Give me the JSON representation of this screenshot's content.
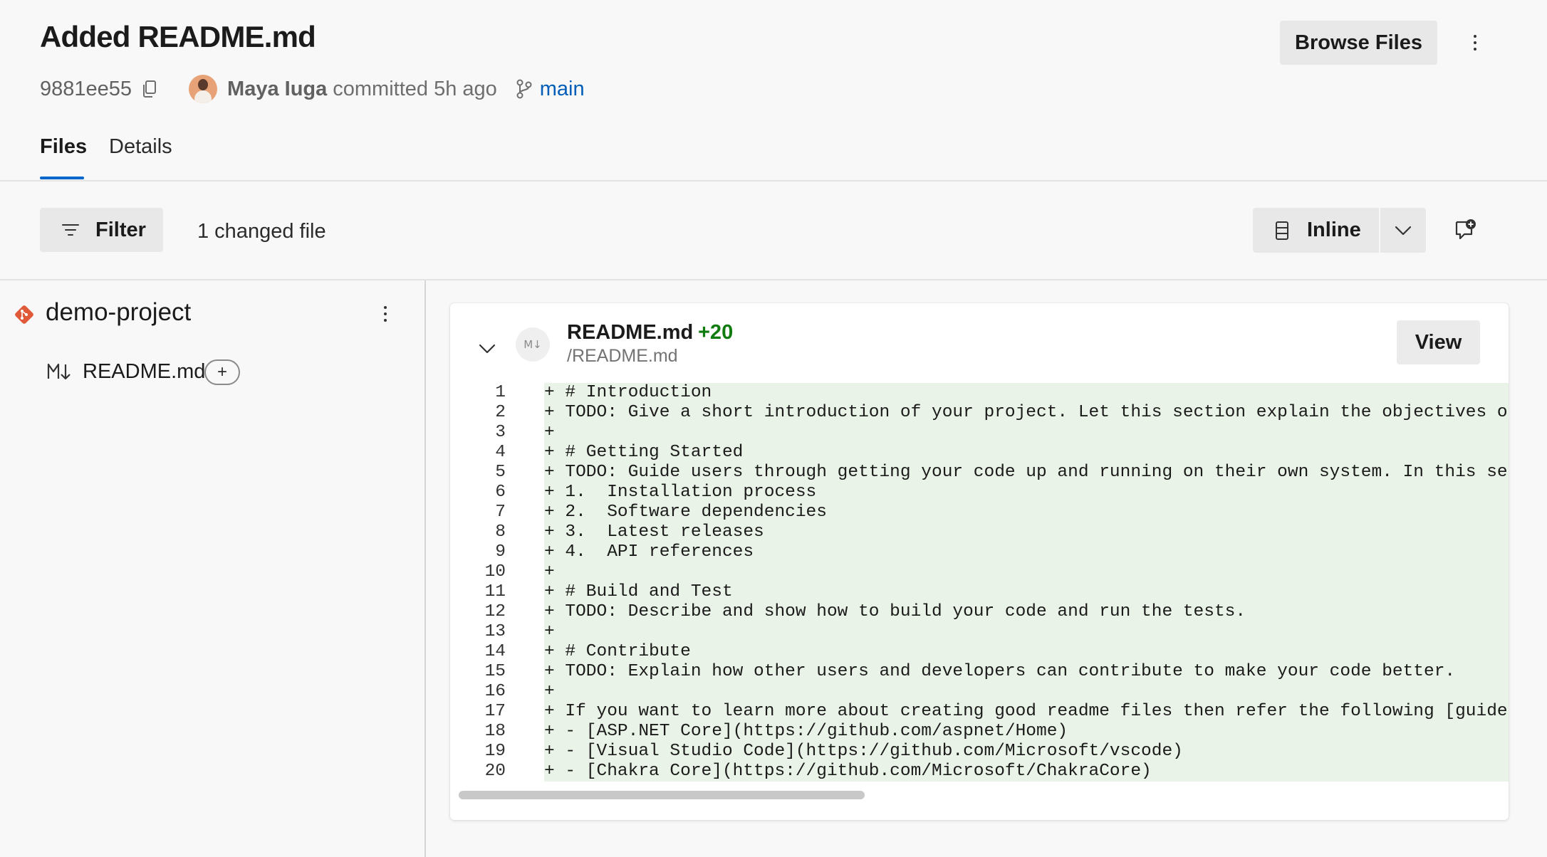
{
  "commit": {
    "title": "Added README.md",
    "hash": "9881ee55",
    "author": "Maya Iuga",
    "committed_text": "committed 5h ago",
    "branch": "main"
  },
  "header": {
    "browse_files_label": "Browse Files"
  },
  "tabs": [
    {
      "label": "Files",
      "active": true
    },
    {
      "label": "Details",
      "active": false
    }
  ],
  "toolbar": {
    "filter_label": "Filter",
    "changed_files": "1 changed file",
    "view_mode": "Inline"
  },
  "sidebar": {
    "repo_name": "demo-project",
    "files": [
      {
        "name": "README.md",
        "badge": "+"
      }
    ]
  },
  "diff_card": {
    "file_name": "README.md",
    "additions": "+20",
    "path": "/README.md",
    "file_icon_text": "M↓",
    "view_label": "View",
    "lines": [
      {
        "n": "1",
        "text": "+ # Introduction"
      },
      {
        "n": "2",
        "text": "+ TODO: Give a short introduction of your project. Let this section explain the objectives or"
      },
      {
        "n": "3",
        "text": "+"
      },
      {
        "n": "4",
        "text": "+ # Getting Started"
      },
      {
        "n": "5",
        "text": "+ TODO: Guide users through getting your code up and running on their own system. In this sect"
      },
      {
        "n": "6",
        "text": "+ 1.  Installation process"
      },
      {
        "n": "7",
        "text": "+ 2.  Software dependencies"
      },
      {
        "n": "8",
        "text": "+ 3.  Latest releases"
      },
      {
        "n": "9",
        "text": "+ 4.  API references"
      },
      {
        "n": "10",
        "text": "+"
      },
      {
        "n": "11",
        "text": "+ # Build and Test"
      },
      {
        "n": "12",
        "text": "+ TODO: Describe and show how to build your code and run the tests."
      },
      {
        "n": "13",
        "text": "+"
      },
      {
        "n": "14",
        "text": "+ # Contribute"
      },
      {
        "n": "15",
        "text": "+ TODO: Explain how other users and developers can contribute to make your code better."
      },
      {
        "n": "16",
        "text": "+"
      },
      {
        "n": "17",
        "text": "+ If you want to learn more about creating good readme files then refer the following [guideli"
      },
      {
        "n": "18",
        "text": "+ - [ASP.NET Core](https://github.com/aspnet/Home)"
      },
      {
        "n": "19",
        "text": "+ - [Visual Studio Code](https://github.com/Microsoft/vscode)"
      },
      {
        "n": "20",
        "text": "+ - [Chakra Core](https://github.com/Microsoft/ChakraCore)"
      }
    ]
  },
  "colors": {
    "accent": "#0066cc",
    "branch_link": "#005eb8",
    "additions": "#107c10",
    "added_line_bg": "#eaf3e7",
    "git_repo": "#e05a3a"
  },
  "icons": [
    "copy-icon",
    "branch-icon",
    "filter-icon",
    "inline-view-icon",
    "chevron-down-icon",
    "add-comment-icon",
    "git-repo-icon",
    "markdown-icon",
    "more-options-icon"
  ]
}
